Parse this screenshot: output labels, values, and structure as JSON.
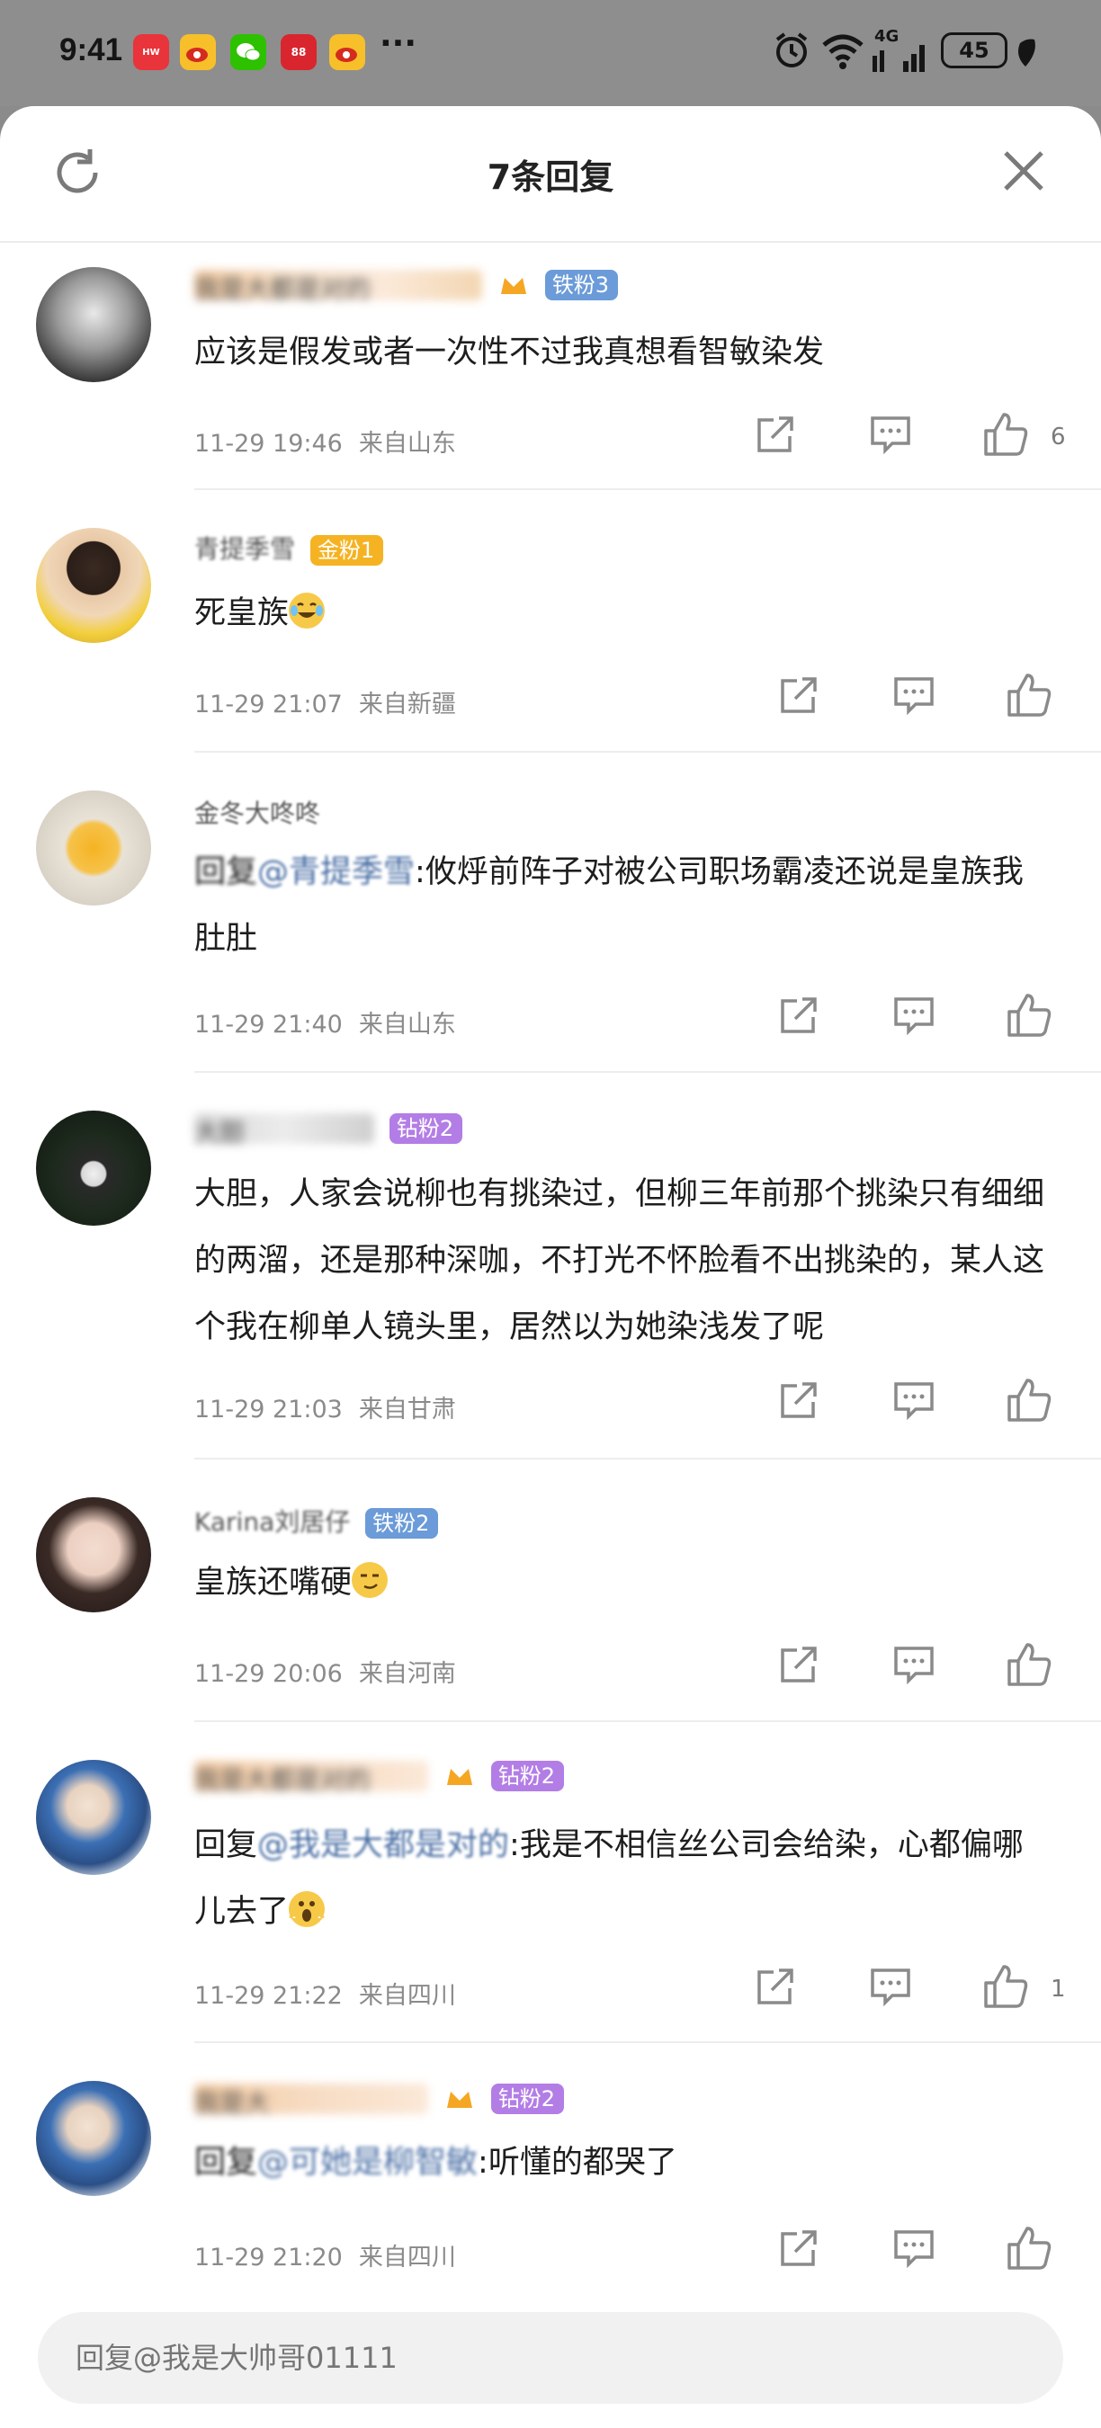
{
  "status_bar": {
    "time": "9:41",
    "battery": "45",
    "network": "4G",
    "more": "···"
  },
  "sheet": {
    "title": "7条回复"
  },
  "comments": [
    {
      "username": "我是大都是对的",
      "badge": "铁粉3",
      "badge_color": "#6b9bd8",
      "text": "应该是假发或者一次性不过我真想看智敏染发",
      "date": "11-29 19:46",
      "location": "来自山东",
      "likes": "6"
    },
    {
      "username": "青提季雪",
      "badge": "金粉1",
      "badge_color": "#f5b323",
      "text": "死皇族",
      "date": "11-29 21:07",
      "location": "来自新疆",
      "likes": ""
    },
    {
      "username": "金冬大咚咚",
      "badge": "",
      "badge_color": "",
      "reply_prefix": "回复",
      "mention": "@青提季雪",
      "text": ":攸烀前阵子对被公司职场霸凌还说是皇族我肚肚",
      "date": "11-29 21:40",
      "location": "来自山东",
      "likes": ""
    },
    {
      "username": "大胆",
      "badge": "钻粉2",
      "badge_color": "#b37de6",
      "text": "大胆，人家会说柳也有挑染过，但柳三年前那个挑染只有细细的两溜，还是那种深咖，不打光不怀脸看不出挑染的，某人这个我在柳单人镜头里，居然以为她染浅发了呢",
      "date": "11-29 21:03",
      "location": "来自甘肃",
      "likes": ""
    },
    {
      "username": "Karina刘居仔",
      "badge": "铁粉2",
      "badge_color": "#6b9bd8",
      "text": "皇族还嘴硬",
      "date": "11-29 20:06",
      "location": "来自河南",
      "likes": ""
    },
    {
      "username": "我是大都是对的",
      "badge": "钻粉2",
      "badge_color": "#b37de6",
      "reply_prefix": "回复",
      "mention": "@我是大都是对的",
      "text": ":我是不相信丝公司会给染，心都偏哪儿去了",
      "date": "11-29 21:22",
      "location": "来自四川",
      "likes": "1"
    },
    {
      "username": "我是大",
      "badge": "钻粉2",
      "badge_color": "#b37de6",
      "reply_prefix": "回复",
      "mention": "@可她是柳智敏",
      "text": ":听懂的都哭了",
      "date": "11-29 21:20",
      "location": "来自四川",
      "likes": ""
    }
  ],
  "reply_input": {
    "placeholder": "回复@我是大帅哥01111"
  }
}
